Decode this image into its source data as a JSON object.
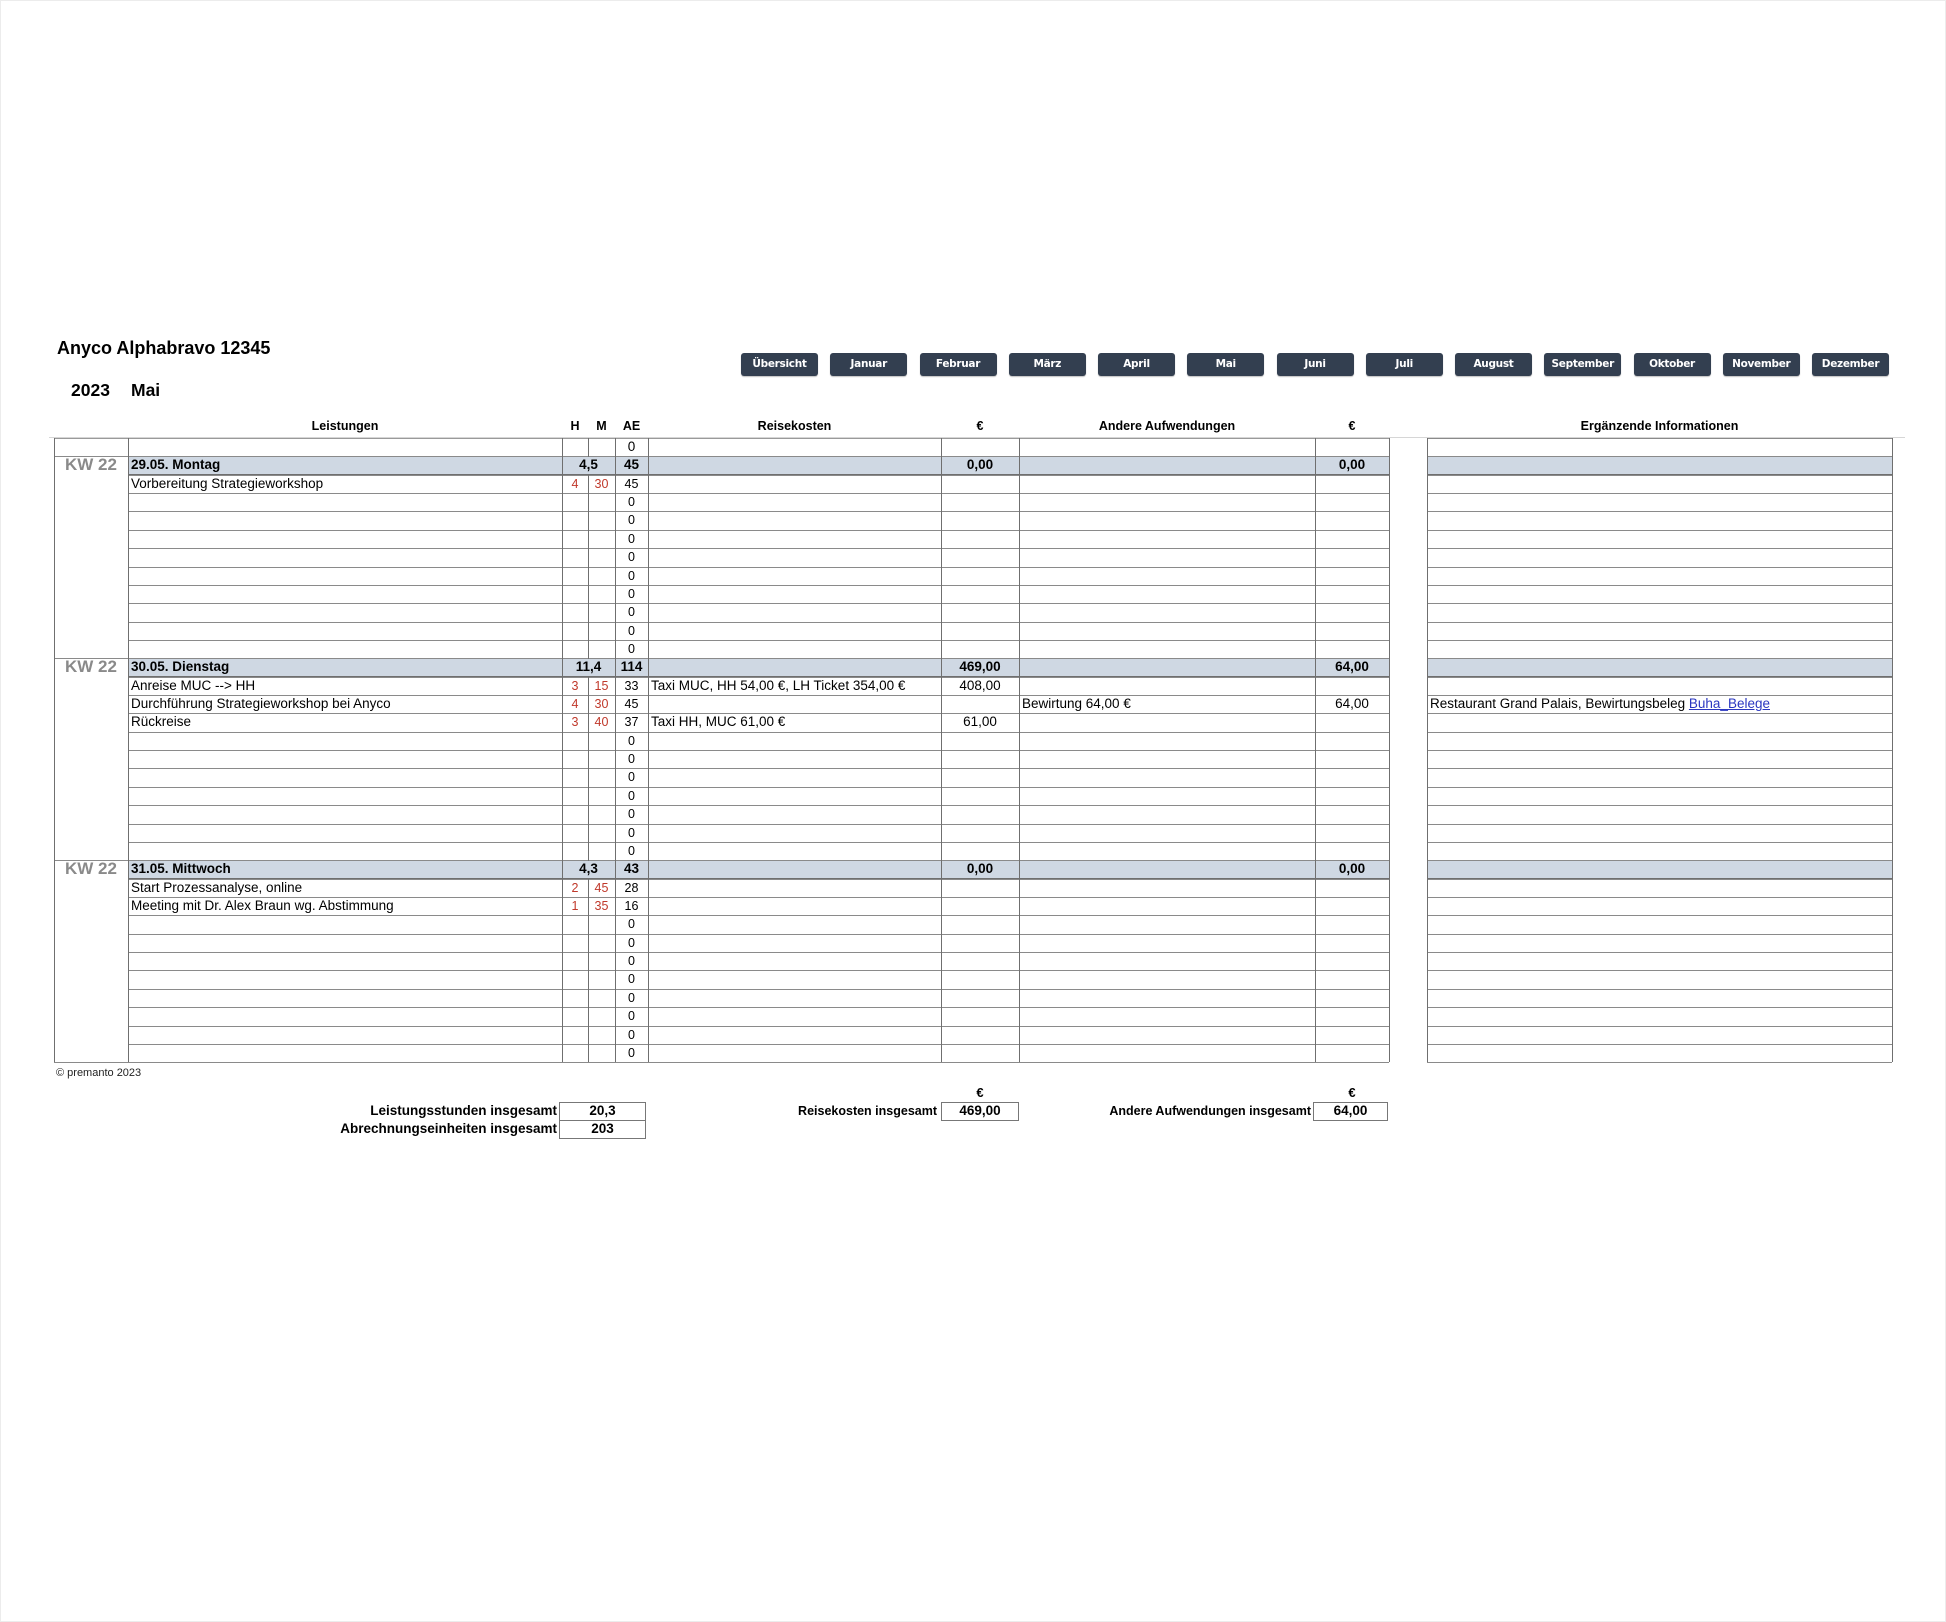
{
  "header": {
    "title": "Anyco Alphabravo 12345",
    "year": "2023",
    "month": "Mai"
  },
  "month_nav": [
    "Übersicht",
    "Januar",
    "Februar",
    "März",
    "April",
    "Mai",
    "Juni",
    "Juli",
    "August",
    "September",
    "Oktober",
    "November",
    "Dezember"
  ],
  "columns": {
    "leistungen": "Leistungen",
    "h": "H",
    "m": "M",
    "ae": "AE",
    "reisekosten": "Reisekosten",
    "reise_eur": "€",
    "andere": "Andere Aufwendungen",
    "andere_eur": "€",
    "info": "Ergänzende Informationen"
  },
  "carry_row": {
    "ae": "0"
  },
  "days": [
    {
      "kw": "KW 22",
      "label": "29.05. Montag",
      "hours": "4,5",
      "ae": "45",
      "reise_total": "0,00",
      "andere_total": "0,00",
      "entries": [
        {
          "leistung": "Vorbereitung Strategieworkshop",
          "h": "4",
          "m": "30",
          "ae": "45",
          "reise": "",
          "reise_eur": "",
          "andere": "",
          "andere_eur": "",
          "info": "",
          "info_link": ""
        },
        {
          "leistung": "",
          "h": "",
          "m": "",
          "ae": "0",
          "reise": "",
          "reise_eur": "",
          "andere": "",
          "andere_eur": "",
          "info": "",
          "info_link": ""
        },
        {
          "leistung": "",
          "h": "",
          "m": "",
          "ae": "0",
          "reise": "",
          "reise_eur": "",
          "andere": "",
          "andere_eur": "",
          "info": "",
          "info_link": ""
        },
        {
          "leistung": "",
          "h": "",
          "m": "",
          "ae": "0",
          "reise": "",
          "reise_eur": "",
          "andere": "",
          "andere_eur": "",
          "info": "",
          "info_link": ""
        },
        {
          "leistung": "",
          "h": "",
          "m": "",
          "ae": "0",
          "reise": "",
          "reise_eur": "",
          "andere": "",
          "andere_eur": "",
          "info": "",
          "info_link": ""
        },
        {
          "leistung": "",
          "h": "",
          "m": "",
          "ae": "0",
          "reise": "",
          "reise_eur": "",
          "andere": "",
          "andere_eur": "",
          "info": "",
          "info_link": ""
        },
        {
          "leistung": "",
          "h": "",
          "m": "",
          "ae": "0",
          "reise": "",
          "reise_eur": "",
          "andere": "",
          "andere_eur": "",
          "info": "",
          "info_link": ""
        },
        {
          "leistung": "",
          "h": "",
          "m": "",
          "ae": "0",
          "reise": "",
          "reise_eur": "",
          "andere": "",
          "andere_eur": "",
          "info": "",
          "info_link": ""
        },
        {
          "leistung": "",
          "h": "",
          "m": "",
          "ae": "0",
          "reise": "",
          "reise_eur": "",
          "andere": "",
          "andere_eur": "",
          "info": "",
          "info_link": ""
        },
        {
          "leistung": "",
          "h": "",
          "m": "",
          "ae": "0",
          "reise": "",
          "reise_eur": "",
          "andere": "",
          "andere_eur": "",
          "info": "",
          "info_link": ""
        }
      ]
    },
    {
      "kw": "KW 22",
      "label": "30.05. Dienstag",
      "hours": "11,4",
      "ae": "114",
      "reise_total": "469,00",
      "andere_total": "64,00",
      "entries": [
        {
          "leistung": "Anreise MUC --> HH",
          "h": "3",
          "m": "15",
          "ae": "33",
          "reise": "Taxi MUC, HH 54,00 €, LH Ticket 354,00 €",
          "reise_eur": "408,00",
          "andere": "",
          "andere_eur": "",
          "info": "",
          "info_link": ""
        },
        {
          "leistung": "Durchführung Strategieworkshop bei Anyco",
          "h": "4",
          "m": "30",
          "ae": "45",
          "reise": "",
          "reise_eur": "",
          "andere": "Bewirtung 64,00 €",
          "andere_eur": "64,00",
          "info": "Restaurant Grand Palais, Bewirtungsbeleg ",
          "info_link": "Buha_Belege"
        },
        {
          "leistung": "Rückreise",
          "h": "3",
          "m": "40",
          "ae": "37",
          "reise": "Taxi HH, MUC 61,00 €",
          "reise_eur": "61,00",
          "andere": "",
          "andere_eur": "",
          "info": "",
          "info_link": ""
        },
        {
          "leistung": "",
          "h": "",
          "m": "",
          "ae": "0",
          "reise": "",
          "reise_eur": "",
          "andere": "",
          "andere_eur": "",
          "info": "",
          "info_link": ""
        },
        {
          "leistung": "",
          "h": "",
          "m": "",
          "ae": "0",
          "reise": "",
          "reise_eur": "",
          "andere": "",
          "andere_eur": "",
          "info": "",
          "info_link": ""
        },
        {
          "leistung": "",
          "h": "",
          "m": "",
          "ae": "0",
          "reise": "",
          "reise_eur": "",
          "andere": "",
          "andere_eur": "",
          "info": "",
          "info_link": ""
        },
        {
          "leistung": "",
          "h": "",
          "m": "",
          "ae": "0",
          "reise": "",
          "reise_eur": "",
          "andere": "",
          "andere_eur": "",
          "info": "",
          "info_link": ""
        },
        {
          "leistung": "",
          "h": "",
          "m": "",
          "ae": "0",
          "reise": "",
          "reise_eur": "",
          "andere": "",
          "andere_eur": "",
          "info": "",
          "info_link": ""
        },
        {
          "leistung": "",
          "h": "",
          "m": "",
          "ae": "0",
          "reise": "",
          "reise_eur": "",
          "andere": "",
          "andere_eur": "",
          "info": "",
          "info_link": ""
        },
        {
          "leistung": "",
          "h": "",
          "m": "",
          "ae": "0",
          "reise": "",
          "reise_eur": "",
          "andere": "",
          "andere_eur": "",
          "info": "",
          "info_link": ""
        }
      ]
    },
    {
      "kw": "KW 22",
      "label": "31.05. Mittwoch",
      "hours": "4,3",
      "ae": "43",
      "reise_total": "0,00",
      "andere_total": "0,00",
      "entries": [
        {
          "leistung": "Start Prozessanalyse, online",
          "h": "2",
          "m": "45",
          "ae": "28",
          "reise": "",
          "reise_eur": "",
          "andere": "",
          "andere_eur": "",
          "info": "",
          "info_link": ""
        },
        {
          "leistung": "Meeting mit Dr. Alex Braun wg. Abstimmung",
          "h": "1",
          "m": "35",
          "ae": "16",
          "reise": "",
          "reise_eur": "",
          "andere": "",
          "andere_eur": "",
          "info": "",
          "info_link": ""
        },
        {
          "leistung": "",
          "h": "",
          "m": "",
          "ae": "0",
          "reise": "",
          "reise_eur": "",
          "andere": "",
          "andere_eur": "",
          "info": "",
          "info_link": ""
        },
        {
          "leistung": "",
          "h": "",
          "m": "",
          "ae": "0",
          "reise": "",
          "reise_eur": "",
          "andere": "",
          "andere_eur": "",
          "info": "",
          "info_link": ""
        },
        {
          "leistung": "",
          "h": "",
          "m": "",
          "ae": "0",
          "reise": "",
          "reise_eur": "",
          "andere": "",
          "andere_eur": "",
          "info": "",
          "info_link": ""
        },
        {
          "leistung": "",
          "h": "",
          "m": "",
          "ae": "0",
          "reise": "",
          "reise_eur": "",
          "andere": "",
          "andere_eur": "",
          "info": "",
          "info_link": ""
        },
        {
          "leistung": "",
          "h": "",
          "m": "",
          "ae": "0",
          "reise": "",
          "reise_eur": "",
          "andere": "",
          "andere_eur": "",
          "info": "",
          "info_link": ""
        },
        {
          "leistung": "",
          "h": "",
          "m": "",
          "ae": "0",
          "reise": "",
          "reise_eur": "",
          "andere": "",
          "andere_eur": "",
          "info": "",
          "info_link": ""
        },
        {
          "leistung": "",
          "h": "",
          "m": "",
          "ae": "0",
          "reise": "",
          "reise_eur": "",
          "andere": "",
          "andere_eur": "",
          "info": "",
          "info_link": ""
        },
        {
          "leistung": "",
          "h": "",
          "m": "",
          "ae": "0",
          "reise": "",
          "reise_eur": "",
          "andere": "",
          "andere_eur": "",
          "info": "",
          "info_link": ""
        }
      ]
    }
  ],
  "footer": {
    "copyright": "© premanto 2023"
  },
  "totals": {
    "leistungsstunden_label": "Leistungsstunden insgesamt",
    "leistungsstunden_value": "20,3",
    "abrechnungseinheiten_label": "Abrechnungseinheiten insgesamt",
    "abrechnungseinheiten_value": "203",
    "reisekosten_currency": "€",
    "reisekosten_label": "Reisekosten insgesamt",
    "reisekosten_value": "469,00",
    "andere_currency": "€",
    "andere_label": "Andere Aufwendungen insgesamt",
    "andere_value": "64,00"
  },
  "colors": {
    "nav_button_bg": "#333f50",
    "day_row_bg": "#cfd8e3",
    "time_red": "#c0392b",
    "kw_gray": "#8a8a8a",
    "link_blue": "#2a36c0"
  }
}
